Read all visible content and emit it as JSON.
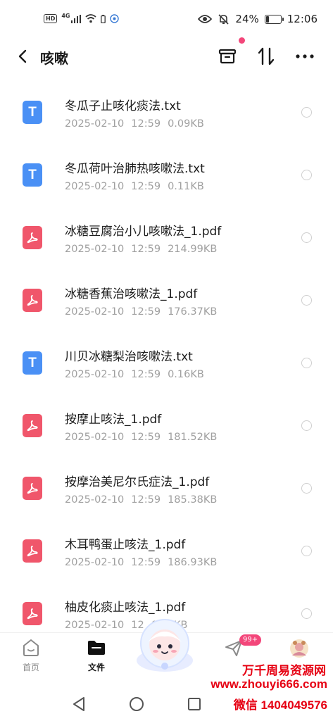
{
  "status_bar": {
    "left_badges": [
      "HD",
      "4G"
    ],
    "battery_text": "24%",
    "battery_level": 0.24,
    "time": "12:06"
  },
  "header": {
    "title": "咳嗽",
    "icons": [
      "back-icon",
      "archive-icon",
      "sort-icon",
      "more-icon"
    ]
  },
  "files": [
    {
      "name": "冬瓜子止咳化痰法.txt",
      "date": "2025-02-10",
      "time": "12:59",
      "size": "0.09KB",
      "type": "txt"
    },
    {
      "name": "冬瓜荷叶治肺热咳嗽法.txt",
      "date": "2025-02-10",
      "time": "12:59",
      "size": "0.11KB",
      "type": "txt"
    },
    {
      "name": "冰糖豆腐治小儿咳嗽法_1.pdf",
      "date": "2025-02-10",
      "time": "12:59",
      "size": "214.99KB",
      "type": "pdf"
    },
    {
      "name": "冰糖香蕉治咳嗽法_1.pdf",
      "date": "2025-02-10",
      "time": "12:59",
      "size": "176.37KB",
      "type": "pdf"
    },
    {
      "name": "川贝冰糖梨治咳嗽法.txt",
      "date": "2025-02-10",
      "time": "12:59",
      "size": "0.16KB",
      "type": "txt"
    },
    {
      "name": "按摩止咳法_1.pdf",
      "date": "2025-02-10",
      "time": "12:59",
      "size": "181.52KB",
      "type": "pdf"
    },
    {
      "name": "按摩治美尼尔氏症法_1.pdf",
      "date": "2025-02-10",
      "time": "12:59",
      "size": "185.38KB",
      "type": "pdf"
    },
    {
      "name": "木耳鸭蛋止咳法_1.pdf",
      "date": "2025-02-10",
      "time": "12:59",
      "size": "186.93KB",
      "type": "pdf"
    },
    {
      "name": "柚皮化痰止咳法_1.pdf",
      "date": "2025-02-10",
      "time": "12",
      "size": "0.95KB",
      "type": "pdf"
    }
  ],
  "tabbar": {
    "home_label": "首页",
    "files_label": "文件",
    "badge": "99+"
  },
  "watermark": {
    "line1": "万千周易资源网",
    "line2": "www.zhouyi666.com",
    "line3": "微信 1404049576"
  },
  "colors": {
    "txt_icon": "#4a90f5",
    "pdf_icon": "#f0566b",
    "accent_pink": "#f3467a",
    "watermark_red": "#e60012"
  }
}
